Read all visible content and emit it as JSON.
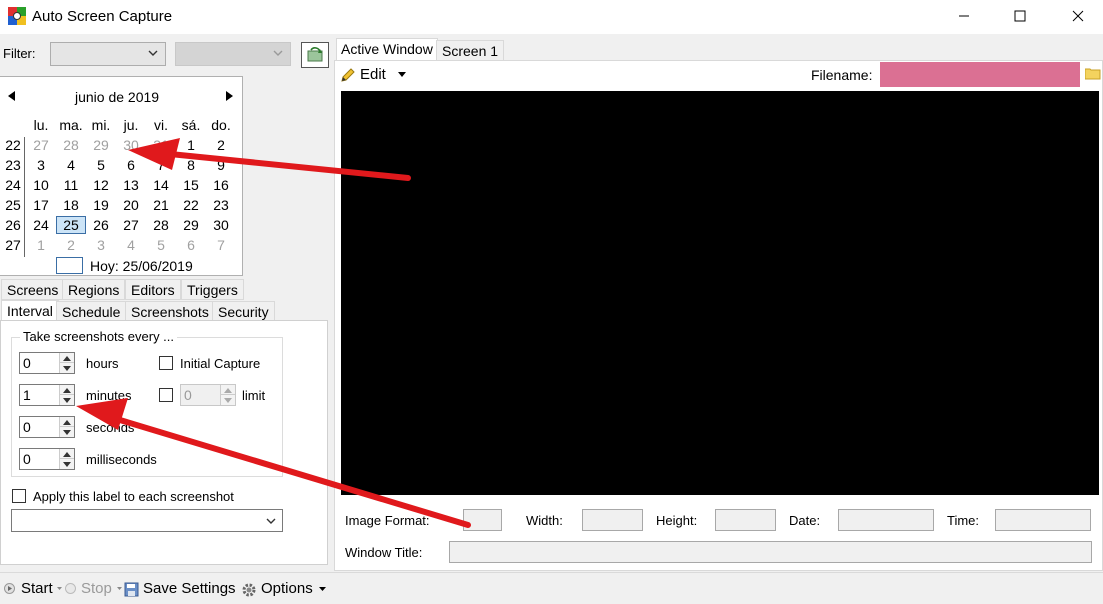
{
  "window": {
    "title": "Auto Screen Capture"
  },
  "filter": {
    "label": "Filter:"
  },
  "calendar": {
    "month_title": "junio de 2019",
    "day_headers": [
      "lu.",
      "ma.",
      "mi.",
      "ju.",
      "vi.",
      "sá.",
      "do."
    ],
    "weeks": [
      {
        "num": "22",
        "days": [
          "27",
          "28",
          "29",
          "30",
          "31",
          "1",
          "2"
        ]
      },
      {
        "num": "23",
        "days": [
          "3",
          "4",
          "5",
          "6",
          "7",
          "8",
          "9"
        ]
      },
      {
        "num": "24",
        "days": [
          "10",
          "11",
          "12",
          "13",
          "14",
          "15",
          "16"
        ]
      },
      {
        "num": "25",
        "days": [
          "17",
          "18",
          "19",
          "20",
          "21",
          "22",
          "23"
        ]
      },
      {
        "num": "26",
        "days": [
          "24",
          "25",
          "26",
          "27",
          "28",
          "29",
          "30"
        ]
      },
      {
        "num": "27",
        "days": [
          "1",
          "2",
          "3",
          "4",
          "5",
          "6",
          "7"
        ]
      }
    ],
    "today_label": "Hoy: 25/06/2019"
  },
  "tabs_row1": [
    "Screens",
    "Regions",
    "Editors",
    "Triggers"
  ],
  "tabs_row2": [
    "Interval",
    "Schedule",
    "Screenshots",
    "Security"
  ],
  "interval": {
    "group_title": "Take screenshots every ...",
    "hours_value": "0",
    "hours_label": "hours",
    "minutes_value": "1",
    "minutes_label": "minutes",
    "seconds_value": "0",
    "seconds_label": "seconds",
    "ms_value": "0",
    "ms_label": "milliseconds",
    "initial_capture_label": "Initial Capture",
    "limit_value": "0",
    "limit_label": "limit",
    "apply_label": "Apply this label to each screenshot"
  },
  "right_tabs": [
    "Active Window",
    "Screen 1"
  ],
  "editor": {
    "edit_label": "Edit",
    "filename_label": "Filename:"
  },
  "info": {
    "image_format": "Image Format:",
    "width": "Width:",
    "height": "Height:",
    "date": "Date:",
    "time": "Time:",
    "window_title": "Window Title:"
  },
  "toolbar": {
    "start": "Start",
    "stop": "Stop",
    "save_settings": "Save Settings",
    "options": "Options"
  },
  "colors": {
    "filename_field": "#db7093",
    "arrow": "#e0191c"
  }
}
